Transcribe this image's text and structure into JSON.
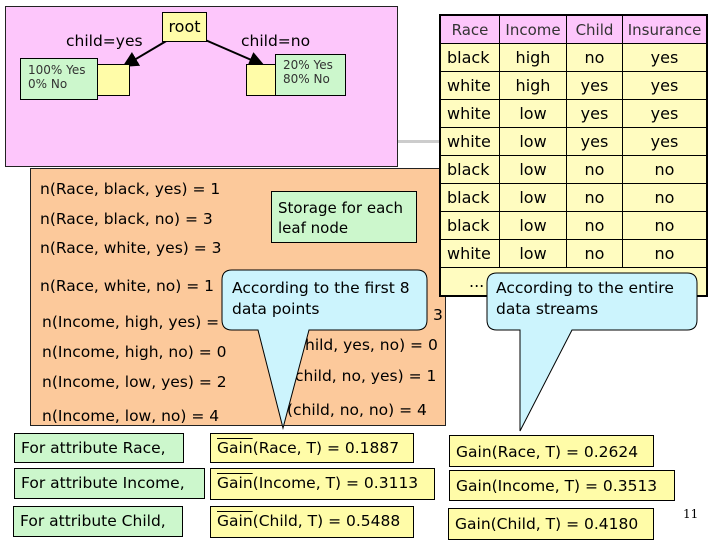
{
  "tree": {
    "root": "root",
    "left_edge": "child=yes",
    "right_edge": "child=no",
    "left_leaf": [
      "100% Yes",
      "0% No"
    ],
    "right_leaf": [
      "20% Yes",
      "80% No"
    ]
  },
  "counts": [
    "n(Race, black, yes) = 1",
    "n(Race, black, no) = 3",
    "n(Race, white, yes) = 3",
    "n(Race, white, no) = 1",
    "n(Income, high, yes) =",
    "n(Income, high, no) = 0",
    "n(Income, low, yes) = 2",
    "n(Income, low, no) = 4"
  ],
  "counts_partial": [
    "3",
    "hild, yes, no) = 0",
    "child, no, yes) = 1",
    "(child, no, no) = 4"
  ],
  "storage_note": "Storage for each leaf node",
  "callout_left": "According to the first 8 data points",
  "callout_right": "According to the entire data streams",
  "table": {
    "headers": [
      "Race",
      "Income",
      "Child",
      "Insurance"
    ],
    "rows": [
      [
        "black",
        "high",
        "no",
        "yes"
      ],
      [
        "white",
        "high",
        "yes",
        "yes"
      ],
      [
        "white",
        "low",
        "yes",
        "yes"
      ],
      [
        "white",
        "low",
        "yes",
        "yes"
      ],
      [
        "black",
        "low",
        "no",
        "no"
      ],
      [
        "black",
        "low",
        "no",
        "no"
      ],
      [
        "black",
        "low",
        "no",
        "no"
      ],
      [
        "white",
        "low",
        "no",
        "no"
      ]
    ],
    "ellipsis": "..."
  },
  "attributes": [
    "For attribute Race,",
    "For attribute Income,",
    "For attribute Child,"
  ],
  "gain_estimated": [
    {
      "word": "Gain",
      "rest": "(Race, T) = 0.1887"
    },
    {
      "word": "Gain",
      "rest": "(Income, T) = 0.3113"
    },
    {
      "word": "Gain",
      "rest": "(Child, T) = 0.5488"
    }
  ],
  "gain_true": [
    "Gain(Race, T) = 0.2624",
    "Gain(Income, T) = 0.3513",
    "Gain(Child, T) = 0.4180"
  ],
  "page_number": "11"
}
